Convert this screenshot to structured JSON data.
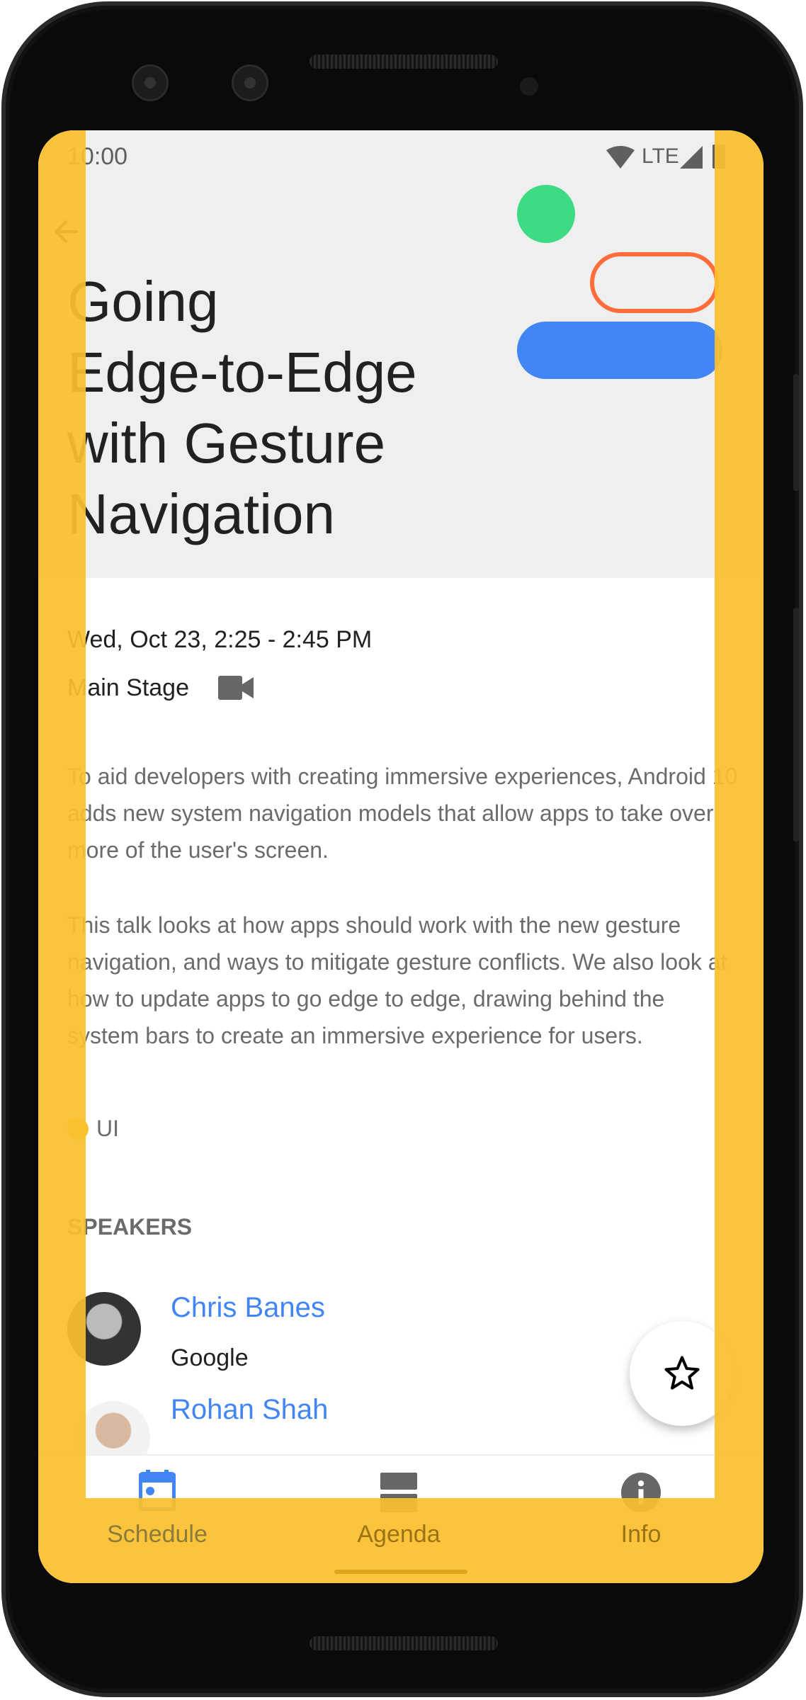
{
  "status_bar": {
    "time": "10:00",
    "network": "LTE"
  },
  "session": {
    "title_lines": [
      "Going",
      "Edge-to-Edge",
      "with Gesture",
      "Navigation"
    ],
    "datetime": "Wed, Oct 23, 2:25 - 2:45 PM",
    "room": "Main Stage",
    "description": [
      "To aid developers with creating immersive experiences, Android 10 adds new system navigation models that allow apps to take over more of the user's screen.",
      "This talk looks at how apps should work with the new gesture navigation, and ways to mitigate gesture conflicts. We also look at how to update apps to go edge to edge, drawing behind the system bars to create an immersive experience for users."
    ],
    "tag": "UI",
    "tag_color": "#fbc02d"
  },
  "speakers": {
    "heading": "SPEAKERS",
    "items": [
      {
        "name": "Chris Banes",
        "company": "Google"
      },
      {
        "name": "Rohan Shah",
        "company": ""
      }
    ]
  },
  "nav": {
    "items": [
      {
        "label": "Schedule",
        "icon": "calendar-icon",
        "active": true
      },
      {
        "label": "Agenda",
        "icon": "agenda-icon",
        "active": false
      },
      {
        "label": "Info",
        "icon": "info-icon",
        "active": false
      }
    ]
  },
  "colors": {
    "accent": "#4285f4",
    "overlay": "#fbc02d",
    "green": "#3ddc84",
    "orange": "#ff6d3a"
  }
}
